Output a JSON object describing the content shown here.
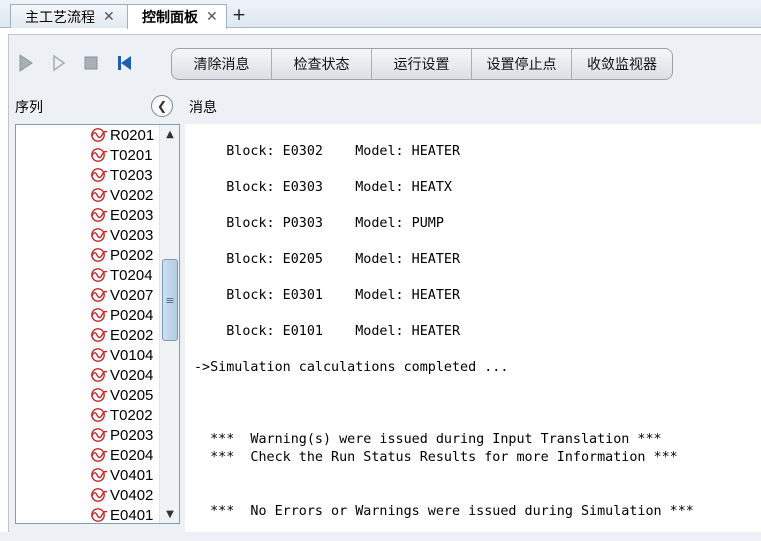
{
  "tabs": [
    {
      "label": "主工艺流程",
      "active": false
    },
    {
      "label": "控制面板",
      "active": true
    }
  ],
  "toolbar": {
    "icons": [
      "play-icon",
      "step-icon",
      "stop-icon",
      "reset-icon"
    ],
    "buttons": [
      "清除消息",
      "检查状态",
      "运行设置",
      "设置停止点",
      "收敛监视器"
    ]
  },
  "left_header": "序列",
  "right_header": "消息",
  "sequence": [
    "R0201",
    "T0201",
    "T0203",
    "V0202",
    "E0203",
    "V0203",
    "P0202",
    "T0204",
    "V0207",
    "P0204",
    "E0202",
    "V0104",
    "V0204",
    "V0205",
    "T0202",
    "P0203",
    "E0204",
    "V0401",
    "V0402",
    "E0401"
  ],
  "messages": [
    "    Block: E0302    Model: HEATER",
    "",
    "    Block: E0303    Model: HEATX",
    "",
    "    Block: P0303    Model: PUMP",
    "",
    "    Block: E0205    Model: HEATER",
    "",
    "    Block: E0301    Model: HEATER",
    "",
    "    Block: E0101    Model: HEATER",
    "",
    "->Simulation calculations completed ...",
    "",
    "",
    "",
    "  ***  Warning(s) were issued during Input Translation ***",
    "  ***  Check the Run Status Results for more Information ***",
    "",
    "",
    "  ***  No Errors or Warnings were issued during Simulation ***"
  ],
  "colors": {
    "accent_blue": "#1a5fb4",
    "icon_red": "#c62828",
    "disabled_gray": "#a8b0b8"
  }
}
